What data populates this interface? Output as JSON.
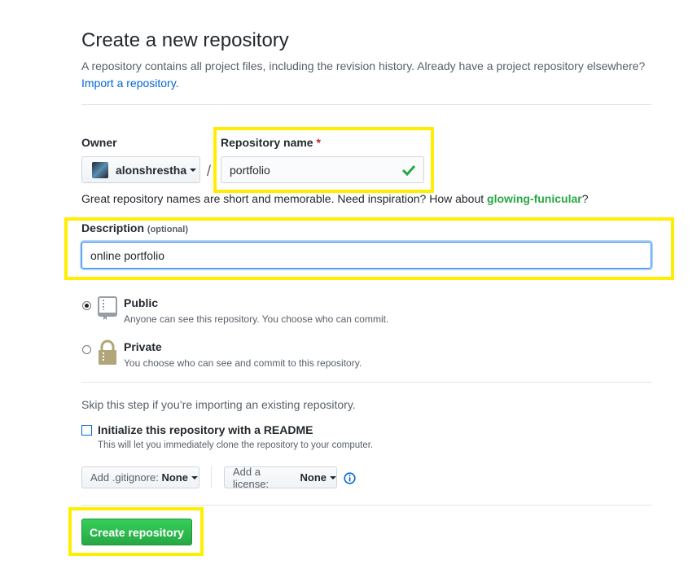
{
  "header": {
    "title": "Create a new repository",
    "subtitle": "A repository contains all project files, including the revision history. Already have a project repository elsewhere?",
    "import_link": "Import a repository."
  },
  "owner": {
    "label": "Owner",
    "value": "alonshrestha",
    "separator": "/"
  },
  "repo_name": {
    "label": "Repository name",
    "required_mark": "*",
    "value": "portfolio"
  },
  "hint": {
    "text": "Great repository names are short and memorable. Need inspiration? How about ",
    "suggestion": "glowing-funicular",
    "end": "?"
  },
  "description": {
    "label": "Description",
    "optional": "(optional)",
    "value": "online portfolio"
  },
  "visibility": [
    {
      "label": "Public",
      "desc": "Anyone can see this repository. You choose who can commit.",
      "selected": true
    },
    {
      "label": "Private",
      "desc": "You choose who can see and commit to this repository.",
      "selected": false
    }
  ],
  "init": {
    "skip_text": "Skip this step if you’re importing an existing repository.",
    "readme_label": "Initialize this repository with a README",
    "readme_desc": "This will let you immediately clone the repository to your computer.",
    "checked": false
  },
  "gitignore": {
    "label": "Add .gitignore:",
    "value": "None"
  },
  "license": {
    "label": "Add a license:",
    "value": "None"
  },
  "submit": {
    "label": "Create repository"
  },
  "colors": {
    "highlight": "#ffee00",
    "accent": "#0366d6",
    "primary": "#28a745"
  }
}
